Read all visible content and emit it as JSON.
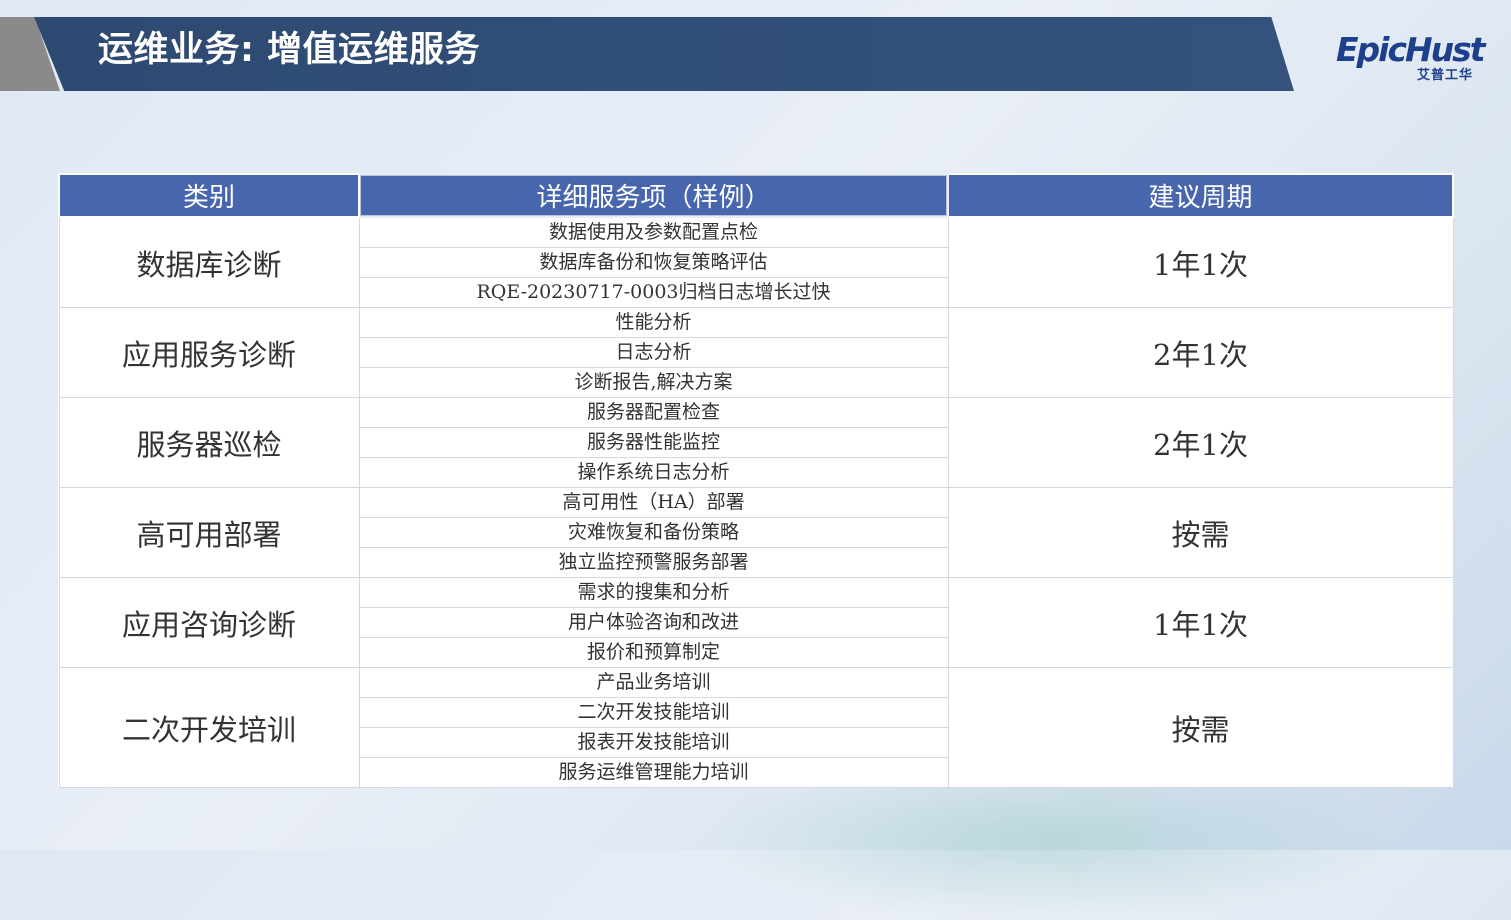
{
  "header": {
    "title": "运维业务: 增值运维服务",
    "logo_main": "EpicHust",
    "logo_sub": "艾普工华"
  },
  "table": {
    "columns": [
      "类别",
      "详细服务项（样例）",
      "建议周期"
    ],
    "groups": [
      {
        "category": "数据库诊断",
        "items": [
          "数据使用及参数配置点检",
          "数据库备份和恢复策略评估",
          "RQE-20230717-0003归档日志增长过快"
        ],
        "period": "1年1次"
      },
      {
        "category": "应用服务诊断",
        "items": [
          "性能分析",
          "日志分析",
          "诊断报告,解决方案"
        ],
        "period": "2年1次"
      },
      {
        "category": "服务器巡检",
        "items": [
          "服务器配置检查",
          "服务器性能监控",
          "操作系统日志分析"
        ],
        "period": "2年1次"
      },
      {
        "category": "高可用部署",
        "items": [
          "高可用性（HA）部署",
          "灾难恢复和备份策略",
          "独立监控预警服务部署"
        ],
        "period": "按需"
      },
      {
        "category": "应用咨询诊断",
        "items": [
          "需求的搜集和分析",
          "用户体验咨询和改进",
          "报价和预算制定"
        ],
        "period": "1年1次"
      },
      {
        "category": "二次开发培训",
        "items": [
          "产品业务培训",
          "二次开发技能培训",
          "报表开发技能培训",
          "服务运维管理能力培训"
        ],
        "period": "按需"
      }
    ]
  }
}
